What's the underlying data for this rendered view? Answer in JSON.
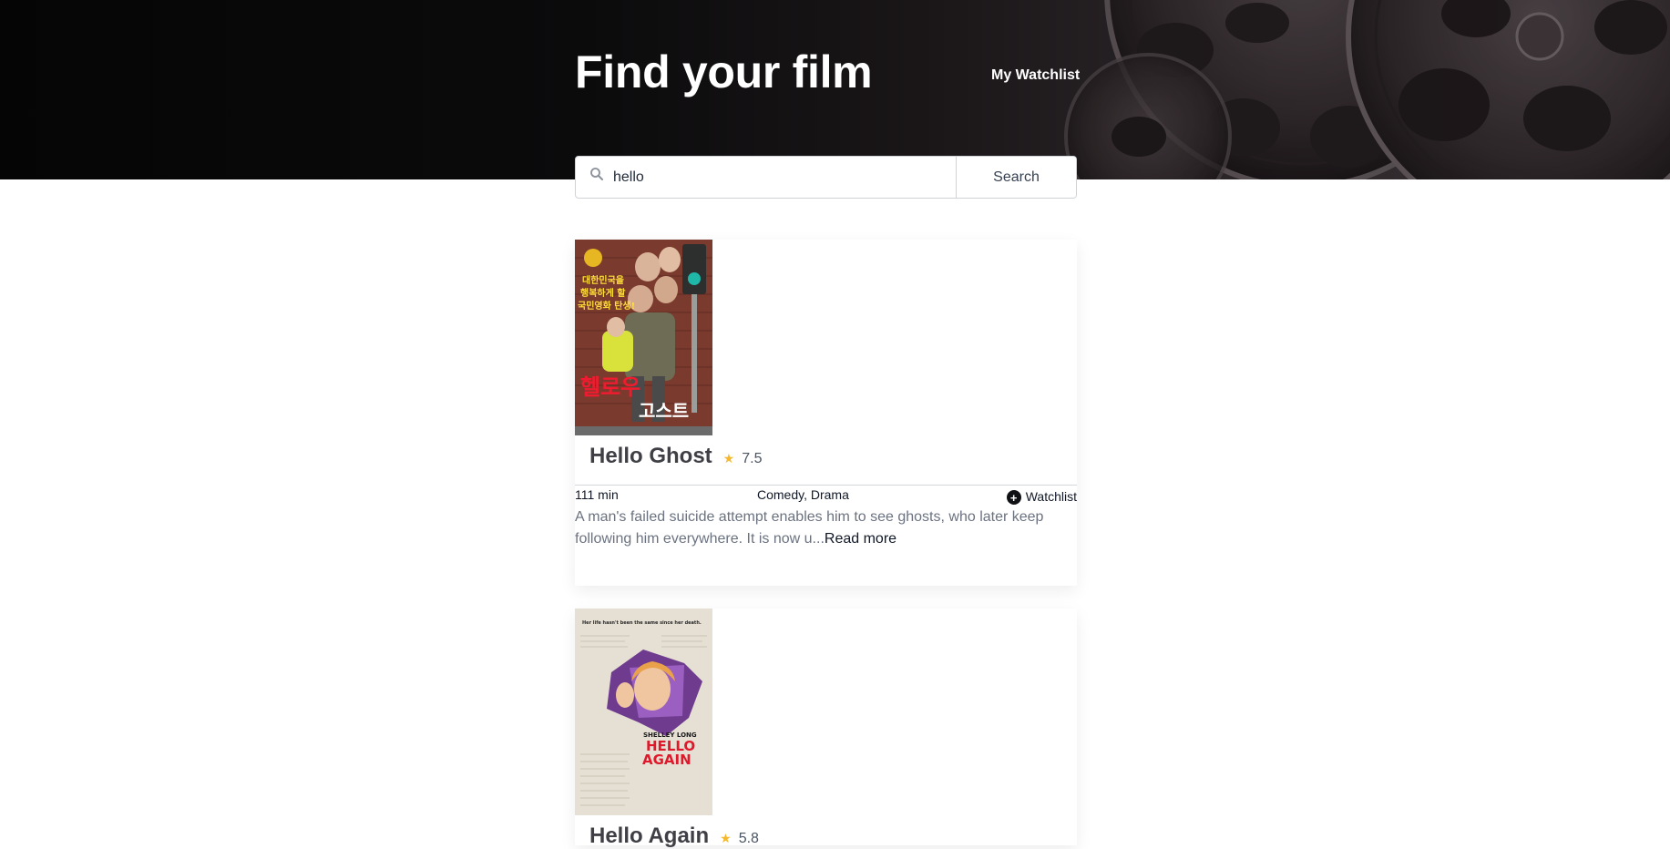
{
  "header": {
    "title": "Find your film",
    "watchlist_link": "My Watchlist"
  },
  "search": {
    "value": "hello",
    "placeholder": "",
    "button_label": "Search",
    "icon": "search-icon"
  },
  "results": [
    {
      "title": "Hello Ghost",
      "rating": "7.5",
      "runtime": "111 min",
      "genres": "Comedy, Drama",
      "watchlist_label": "Watchlist",
      "overview": "A man's failed suicide attempt enables him to see ghosts, who later keep following him everywhere. It is now u...",
      "read_more": "Read more",
      "poster_text": [
        "대한민국을",
        "행복하게 할",
        "국민영화 탄생!",
        "헬로우",
        "고스트"
      ]
    },
    {
      "title": "Hello Again",
      "rating": "5.8",
      "poster_text": [
        "Her life hasn't been the same since her death.",
        "SHELLEY LONG",
        "HELLO",
        "AGAIN"
      ]
    }
  ],
  "colors": {
    "star": "#f5b82e",
    "title": "#3f3f46",
    "overview": "#6b7280",
    "hero_dark": "#050505"
  }
}
